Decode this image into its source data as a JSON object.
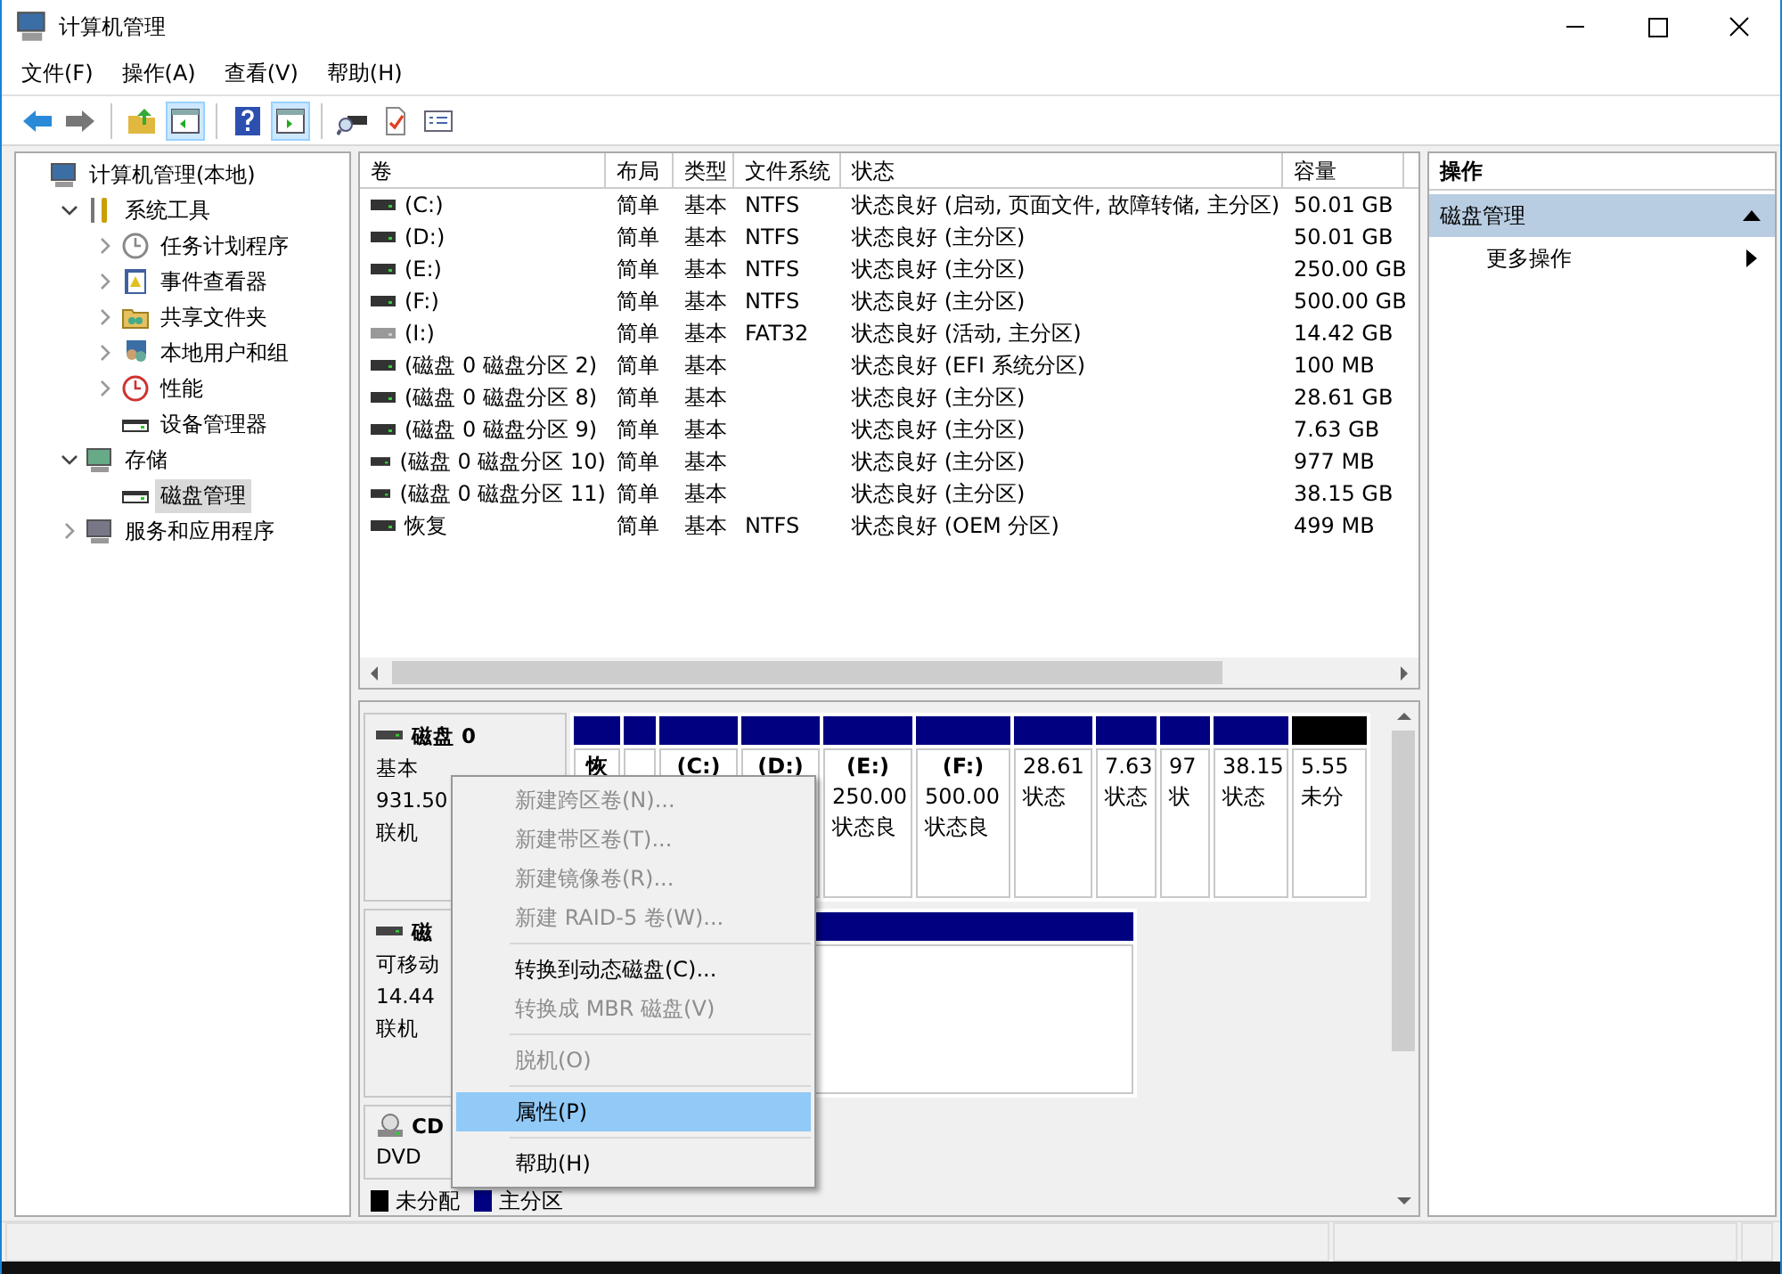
{
  "window": {
    "title": "计算机管理"
  },
  "menu": [
    "文件(F)",
    "操作(A)",
    "查看(V)",
    "帮助(H)"
  ],
  "toolbar": [
    {
      "kind": "back",
      "pressed": false
    },
    {
      "kind": "forward",
      "pressed": false
    },
    {
      "kind": "separator"
    },
    {
      "kind": "up",
      "pressed": false
    },
    {
      "kind": "tree",
      "pressed": true
    },
    {
      "kind": "separator"
    },
    {
      "kind": "help",
      "pressed": false
    },
    {
      "kind": "actions",
      "pressed": true
    },
    {
      "kind": "separator"
    },
    {
      "kind": "rescan",
      "pressed": false
    },
    {
      "kind": "check",
      "pressed": false
    },
    {
      "kind": "list",
      "pressed": false
    }
  ],
  "tree": [
    {
      "label": "计算机管理(本地)",
      "kind": "computer",
      "selected": false,
      "children": [
        {
          "label": "系统工具",
          "kind": "tools",
          "expanded": true,
          "selected": false,
          "children": [
            {
              "label": "任务计划程序",
              "kind": "clock",
              "expanded": false,
              "selected": false
            },
            {
              "label": "事件查看器",
              "kind": "log",
              "expanded": false,
              "selected": false
            },
            {
              "label": "共享文件夹",
              "kind": "folder",
              "expanded": false,
              "selected": false
            },
            {
              "label": "本地用户和组",
              "kind": "users",
              "expanded": false,
              "selected": false
            },
            {
              "label": "性能",
              "kind": "gauge",
              "expanded": false,
              "selected": false
            },
            {
              "label": "设备管理器",
              "kind": "device",
              "selected": false
            }
          ]
        },
        {
          "label": "存储",
          "kind": "storage",
          "expanded": true,
          "selected": false,
          "children": [
            {
              "label": "磁盘管理",
              "kind": "disk",
              "selected": true
            }
          ]
        },
        {
          "label": "服务和应用程序",
          "kind": "services",
          "expanded": false,
          "selected": false
        }
      ]
    }
  ],
  "table": {
    "columns": [
      "卷",
      "布局",
      "类型",
      "文件系统",
      "状态",
      "容量"
    ],
    "rows": [
      {
        "volume": "(C:)",
        "layout": "简单",
        "type": "基本",
        "fs": "NTFS",
        "status": "状态良好 (启动, 页面文件, 故障转储, 主分区)",
        "capacity": "50.01 GB",
        "removable": false
      },
      {
        "volume": "(D:)",
        "layout": "简单",
        "type": "基本",
        "fs": "NTFS",
        "status": "状态良好 (主分区)",
        "capacity": "50.01 GB",
        "removable": false
      },
      {
        "volume": "(E:)",
        "layout": "简单",
        "type": "基本",
        "fs": "NTFS",
        "status": "状态良好 (主分区)",
        "capacity": "250.00 GB",
        "removable": false
      },
      {
        "volume": "(F:)",
        "layout": "简单",
        "type": "基本",
        "fs": "NTFS",
        "status": "状态良好 (主分区)",
        "capacity": "500.00 GB",
        "removable": false
      },
      {
        "volume": "(I:)",
        "layout": "简单",
        "type": "基本",
        "fs": "FAT32",
        "status": "状态良好 (活动, 主分区)",
        "capacity": "14.42 GB",
        "removable": true
      },
      {
        "volume": "(磁盘 0 磁盘分区 2)",
        "layout": "简单",
        "type": "基本",
        "status": "状态良好 (EFI 系统分区)",
        "capacity": "100 MB",
        "removable": false
      },
      {
        "volume": "(磁盘 0 磁盘分区 8)",
        "layout": "简单",
        "type": "基本",
        "status": "状态良好 (主分区)",
        "capacity": "28.61 GB",
        "removable": false
      },
      {
        "volume": "(磁盘 0 磁盘分区 9)",
        "layout": "简单",
        "type": "基本",
        "status": "状态良好 (主分区)",
        "capacity": "7.63 GB",
        "removable": false
      },
      {
        "volume": "(磁盘 0 磁盘分区 10)",
        "layout": "简单",
        "type": "基本",
        "status": "状态良好 (主分区)",
        "capacity": "977 MB",
        "removable": false
      },
      {
        "volume": "(磁盘 0 磁盘分区 11)",
        "layout": "简单",
        "type": "基本",
        "status": "状态良好 (主分区)",
        "capacity": "38.15 GB",
        "removable": false
      },
      {
        "volume": "恢复",
        "layout": "简单",
        "type": "基本",
        "fs": "NTFS",
        "status": "状态良好 (OEM 分区)",
        "capacity": "499 MB",
        "removable": false
      }
    ]
  },
  "disks": [
    {
      "kind": "hdd",
      "name": "磁盘 0",
      "lines": [
        "基本",
        "931.50",
        "联机"
      ],
      "partitions": [
        {
          "kind": "primary",
          "label": "恢"
        },
        {
          "kind": "primary"
        },
        {
          "kind": "primary",
          "label": "(C:)"
        },
        {
          "kind": "primary",
          "label": "(D:)"
        },
        {
          "kind": "primary",
          "label": "(E:)",
          "size": "250.00",
          "status": "状态良"
        },
        {
          "kind": "primary",
          "label": "(F:)",
          "size": "500.00",
          "status": "状态良"
        },
        {
          "kind": "primary",
          "size": "28.61",
          "status": "状态"
        },
        {
          "kind": "primary",
          "size": "7.63",
          "status": "状态"
        },
        {
          "kind": "primary",
          "size": "97",
          "status": "状"
        },
        {
          "kind": "primary",
          "size": "38.15",
          "status": "状态"
        },
        {
          "kind": "unallocated",
          "size": "5.55",
          "status": "未分"
        }
      ]
    },
    {
      "kind": "hdd",
      "name": "磁",
      "lines": [
        "可移动",
        "14.44",
        "联机"
      ],
      "partitions": [
        {
          "kind": "primary"
        }
      ]
    },
    {
      "kind": "cd",
      "name": "CD",
      "lines": [
        "DVD"
      ]
    }
  ],
  "legend": [
    {
      "label": "未分配",
      "color": "#000000"
    },
    {
      "label": "主分区",
      "color": "#000080"
    }
  ],
  "context_menu": [
    {
      "kind": "item",
      "label": "新建跨区卷(N)...",
      "disabled": true,
      "selected": false
    },
    {
      "kind": "item",
      "label": "新建带区卷(T)...",
      "disabled": true,
      "selected": false
    },
    {
      "kind": "item",
      "label": "新建镜像卷(R)...",
      "disabled": true,
      "selected": false
    },
    {
      "kind": "item",
      "label": "新建 RAID-5 卷(W)...",
      "disabled": true,
      "selected": false
    },
    {
      "kind": "separator"
    },
    {
      "kind": "item",
      "label": "转换到动态磁盘(C)...",
      "disabled": false,
      "selected": false
    },
    {
      "kind": "item",
      "label": "转换成 MBR 磁盘(V)",
      "disabled": true,
      "selected": false
    },
    {
      "kind": "separator"
    },
    {
      "kind": "item",
      "label": "脱机(O)",
      "disabled": true,
      "selected": false
    },
    {
      "kind": "separator"
    },
    {
      "kind": "item",
      "label": "属性(P)",
      "disabled": false,
      "selected": true
    },
    {
      "kind": "separator"
    },
    {
      "kind": "item",
      "label": "帮助(H)",
      "disabled": false,
      "selected": false
    }
  ],
  "actions": {
    "title": "操作",
    "section": {
      "label": "磁盘管理",
      "expanded": true
    },
    "items": [
      {
        "label": "更多操作",
        "submenu": true
      }
    ]
  }
}
